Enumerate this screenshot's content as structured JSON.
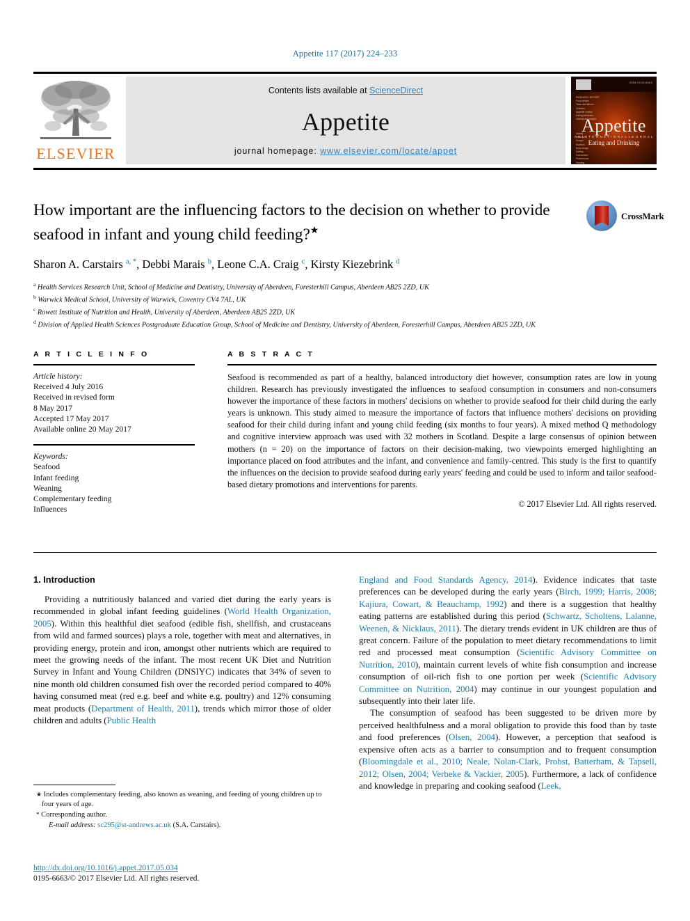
{
  "running_head": "Appetite 117 (2017) 224–233",
  "masthead": {
    "publisher_name": "ELSEVIER",
    "contents_prefix": "Contents lists available at ",
    "contents_link": "ScienceDirect",
    "journal_title": "Appetite",
    "homepage_label": "journal homepage: ",
    "homepage_url": "www.elsevier.com/locate/appet",
    "cover": {
      "title": "Appetite",
      "subtitle_small": "A N   I N T E R N A T I O N A L   J O U R N A L",
      "subtitle": "Eating and Drinking",
      "issn_note": "ISSN 0195-6663",
      "toc_lines": "RESEARCH REPORT\nFood choice\nTaste and flavour\nChildren\nAppetite control\nEating behaviour\nObesity and weight",
      "toc_lines2": "Satiety\nSensory\nHunger\nNutrition\nBody image\nDieting\nConsumers\nPreferences\nFeeding"
    }
  },
  "article": {
    "title": "How important are the influencing factors to the decision on whether to provide seafood in infant and young child feeding?",
    "title_footnote_mark": "★",
    "authors": [
      {
        "name": "Sharon A. Carstairs",
        "marks": "a, *"
      },
      {
        "name": "Debbi Marais",
        "marks": "b"
      },
      {
        "name": "Leone C.A. Craig",
        "marks": "c"
      },
      {
        "name": "Kirsty Kiezebrink",
        "marks": "d"
      }
    ],
    "affiliations": [
      {
        "mark": "a",
        "text": "Health Services Research Unit, School of Medicine and Dentistry, University of Aberdeen, Foresterhill Campus, Aberdeen AB25 2ZD, UK"
      },
      {
        "mark": "b",
        "text": "Warwick Medical School, University of Warwick, Coventry CV4 7AL, UK"
      },
      {
        "mark": "c",
        "text": "Rowett Institute of Nutrition and Health, University of Aberdeen, Aberdeen AB25 2ZD, UK"
      },
      {
        "mark": "d",
        "text": "Division of Applied Health Sciences Postgraduate Education Group, School of Medicine and Dentistry, University of Aberdeen, Foresterhill Campus, Aberdeen AB25 2ZD, UK"
      }
    ],
    "crossmark_label": "CrossMark"
  },
  "article_info": {
    "heading": "A R T I C L E   I N F O",
    "history_label": "Article history:",
    "history": [
      "Received 4 July 2016",
      "Received in revised form",
      "8 May 2017",
      "Accepted 17 May 2017",
      "Available online 20 May 2017"
    ],
    "keywords_label": "Keywords:",
    "keywords": [
      "Seafood",
      "Infant feeding",
      "Weaning",
      "Complementary feeding",
      "Influences"
    ]
  },
  "abstract": {
    "heading": "A B S T R A C T",
    "text": "Seafood is recommended as part of a healthy, balanced introductory diet however, consumption rates are low in young children. Research has previously investigated the influences to seafood consumption in consumers and non-consumers however the importance of these factors in mothers' decisions on whether to provide seafood for their child during the early years is unknown. This study aimed to measure the importance of factors that influence mothers' decisions on providing seafood for their child during infant and young child feeding (six months to four years). A mixed method Q methodology and cognitive interview approach was used with 32 mothers in Scotland. Despite a large consensus of opinion between mothers (n = 20) on the importance of factors on their decision-making, two viewpoints emerged highlighting an importance placed on food attributes and the infant, and convenience and family-centred. This study is the first to quantify the influences on the decision to provide seafood during early years' feeding and could be used to inform and tailor seafood-based dietary promotions and interventions for parents.",
    "copyright": "© 2017 Elsevier Ltd. All rights reserved."
  },
  "body": {
    "section_number_title": "1. Introduction",
    "left_paragraph_parts": [
      {
        "t": "Providing a nutritiously balanced and varied diet during the early years is recommended in global infant feeding guidelines (",
        "k": "plain"
      },
      {
        "t": "World Health Organization, 2005",
        "k": "ref"
      },
      {
        "t": "). Within this healthful diet seafood (edible fish, shellfish, and crustaceans from wild and farmed sources) plays a role, together with meat and alternatives, in providing energy, protein and iron, amongst other nutrients which are required to meet the growing needs of the infant. The most recent UK Diet and Nutrition Survey in Infant and Young Children (DNSIYC) indicates that 34% of seven to nine month old children consumed fish over the recorded period compared to 40% having consumed meat (red e.g. beef and white e.g. poultry) and 12% consuming meat products (",
        "k": "plain"
      },
      {
        "t": "Department of Health, 2011",
        "k": "ref"
      },
      {
        "t": "), trends which mirror those of older children and adults (",
        "k": "plain"
      },
      {
        "t": "Public Health",
        "k": "ref"
      }
    ],
    "right_paragraph1_parts": [
      {
        "t": "England and Food Standards Agency, 2014",
        "k": "ref"
      },
      {
        "t": "). Evidence indicates that taste preferences can be developed during the early years (",
        "k": "plain"
      },
      {
        "t": "Birch, 1999; Harris, 2008; Kajiura, Cowart, & Beauchamp, 1992",
        "k": "ref"
      },
      {
        "t": ") and there is a suggestion that healthy eating patterns are established during this period (",
        "k": "plain"
      },
      {
        "t": "Schwartz, Scholtens, Lalanne, Weenen, & Nicklaus, 2011",
        "k": "ref"
      },
      {
        "t": "). The dietary trends evident in UK children are thus of great concern. Failure of the population to meet dietary recommendations to limit red and processed meat consumption (",
        "k": "plain"
      },
      {
        "t": "Scientific Advisory Committee on Nutrition, 2010",
        "k": "ref"
      },
      {
        "t": "), maintain current levels of white fish consumption and increase consumption of oil-rich fish to one portion per week (",
        "k": "plain"
      },
      {
        "t": "Scientific Advisory Committee on Nutrition, 2004",
        "k": "ref"
      },
      {
        "t": ") may continue in our youngest population and subsequently into their later life.",
        "k": "plain"
      }
    ],
    "right_paragraph2_parts": [
      {
        "t": "The consumption of seafood has been suggested to be driven more by perceived healthfulness and a moral obligation to provide this food than by taste and food preferences (",
        "k": "plain"
      },
      {
        "t": "Olsen, 2004",
        "k": "ref"
      },
      {
        "t": "). However, a perception that seafood is expensive often acts as a barrier to consumption and to frequent consumption (",
        "k": "plain"
      },
      {
        "t": "Bloomingdale et al., 2010; Neale, Nolan-Clark, Probst, Batterham, & Tapsell, 2012; Olsen, 2004; Verbeke & Vackier, 2005",
        "k": "ref"
      },
      {
        "t": "). Furthermore, a lack of confidence and knowledge in preparing and cooking seafood (",
        "k": "plain"
      },
      {
        "t": "Leek,",
        "k": "ref"
      }
    ]
  },
  "footnotes": {
    "star_mark": "★",
    "star_text": "Includes complementary feeding, also known as weaning, and feeding of young children up to four years of age.",
    "corresponding_mark": "*",
    "corresponding_text": "Corresponding author.",
    "email_label": "E-mail address:",
    "email": "sc295@st-andrews.ac.uk",
    "email_suffix": "(S.A. Carstairs)."
  },
  "doi": {
    "url": "http://dx.doi.org/10.1016/j.appet.2017.05.034",
    "issn_line": "0195-6663/© 2017 Elsevier Ltd. All rights reserved."
  },
  "colors": {
    "link_blue": "#1a7eb0",
    "header_blue": "#1a6e9e",
    "elsevier_orange": "#E87722",
    "band_grey": "#e4e4e4"
  }
}
